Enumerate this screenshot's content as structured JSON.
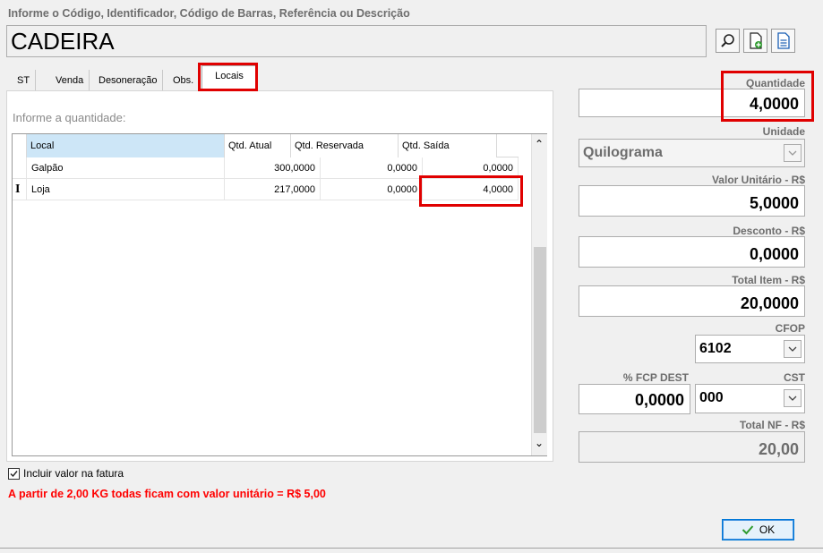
{
  "search": {
    "label": "Informe o Código, Identificador, Código de Barras, Referência ou Descrição",
    "value": "CADEIRA"
  },
  "toolbar": {
    "icons": [
      "search-icon",
      "new-document-icon",
      "document-icon"
    ]
  },
  "tabs": [
    {
      "label": "ST"
    },
    {
      "label": "Venda"
    },
    {
      "label": "Desoneração"
    },
    {
      "label": "Obs."
    },
    {
      "label": "Locais",
      "active": true
    }
  ],
  "locais": {
    "prompt": "Informe a quantidade:",
    "columns": [
      "Local",
      "Qtd. Atual",
      "Qtd. Reservada",
      "Qtd. Saída"
    ],
    "rows": [
      {
        "indicator": "",
        "local": "Galpão",
        "atual": "300,0000",
        "reservada": "0,0000",
        "saida": "0,0000"
      },
      {
        "indicator": "I",
        "local": "Loja",
        "atual": "217,0000",
        "reservada": "0,0000",
        "saida": "4,0000"
      }
    ]
  },
  "form": {
    "quantidade": {
      "label": "Quantidade",
      "value": "4,0000"
    },
    "unidade": {
      "label": "Unidade",
      "value": "Quilograma"
    },
    "valor_unitario": {
      "label": "Valor Unitário - R$",
      "value": "5,0000"
    },
    "desconto": {
      "label": "Desconto - R$",
      "value": "0,0000"
    },
    "total_item": {
      "label": "Total Item - R$",
      "value": "20,0000"
    },
    "cfop": {
      "label": "CFOP",
      "value": "6102"
    },
    "fcp_dest": {
      "label": "% FCP DEST",
      "value": "0,0000"
    },
    "cst": {
      "label": "CST",
      "value": "000"
    },
    "total_nf": {
      "label": "Total NF - R$",
      "value": "20,00"
    }
  },
  "footer": {
    "checkbox_label": "Incluir valor na fatura",
    "checkbox_checked": true,
    "notice": "A partir de 2,00 KG todas ficam com  valor unitário = R$ 5,00",
    "ok_label": "OK"
  },
  "colors": {
    "highlight": "#e00000",
    "notice": "#ff0000",
    "ok_check": "#2e9b2e"
  }
}
